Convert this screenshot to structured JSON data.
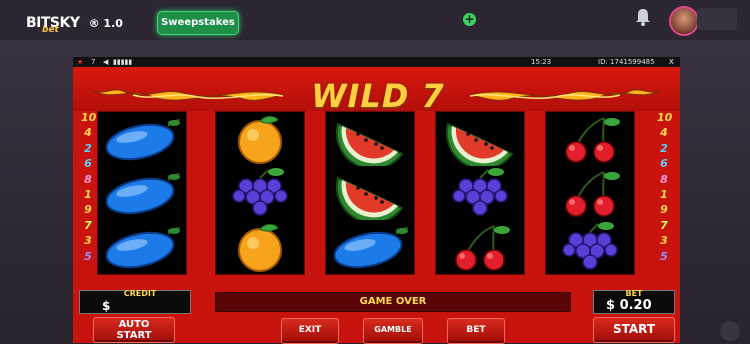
{
  "topbar": {
    "logo": "BITSKY",
    "logo_sub": "bet",
    "version": "® 1.0",
    "sweepstakes_label": "Sweepstakes",
    "add_label": "+"
  },
  "game": {
    "status": {
      "lang": "★",
      "seven": "7",
      "time": "15:23",
      "id": "ID: 1741599485",
      "close": "X"
    },
    "title": "WILD 7",
    "paylines_left": [
      "10",
      "4",
      "2",
      "6",
      "8",
      "1",
      "9",
      "7",
      "3",
      "5"
    ],
    "paylines_right": [
      "10",
      "4",
      "2",
      "6",
      "8",
      "1",
      "9",
      "7",
      "3",
      "5"
    ],
    "payline_colors": [
      "#ffd84a",
      "#ffd84a",
      "#5ad1ff",
      "#5ad1ff",
      "#ff9adf",
      "#ffd84a",
      "#ffd84a",
      "#c8ff5a",
      "#ffd84a",
      "#9a8cff"
    ],
    "reels": [
      [
        "plum",
        "plum",
        "plum"
      ],
      [
        "orange",
        "grapes",
        "orange"
      ],
      [
        "watermelon",
        "watermelon",
        "plum"
      ],
      [
        "watermelon",
        "grapes",
        "cherries"
      ],
      [
        "cherries",
        "cherries",
        "grapes"
      ]
    ],
    "credit_label": "CREDIT",
    "credit_value": "$",
    "message": "GAME OVER",
    "bet_label": "BET",
    "bet_value": "$ 0.20",
    "buttons": {
      "auto_start_1": "AUTO",
      "auto_start_2": "START",
      "exit": "EXIT",
      "gamble": "GAMBLE",
      "bet": "BET",
      "start": "START"
    }
  }
}
